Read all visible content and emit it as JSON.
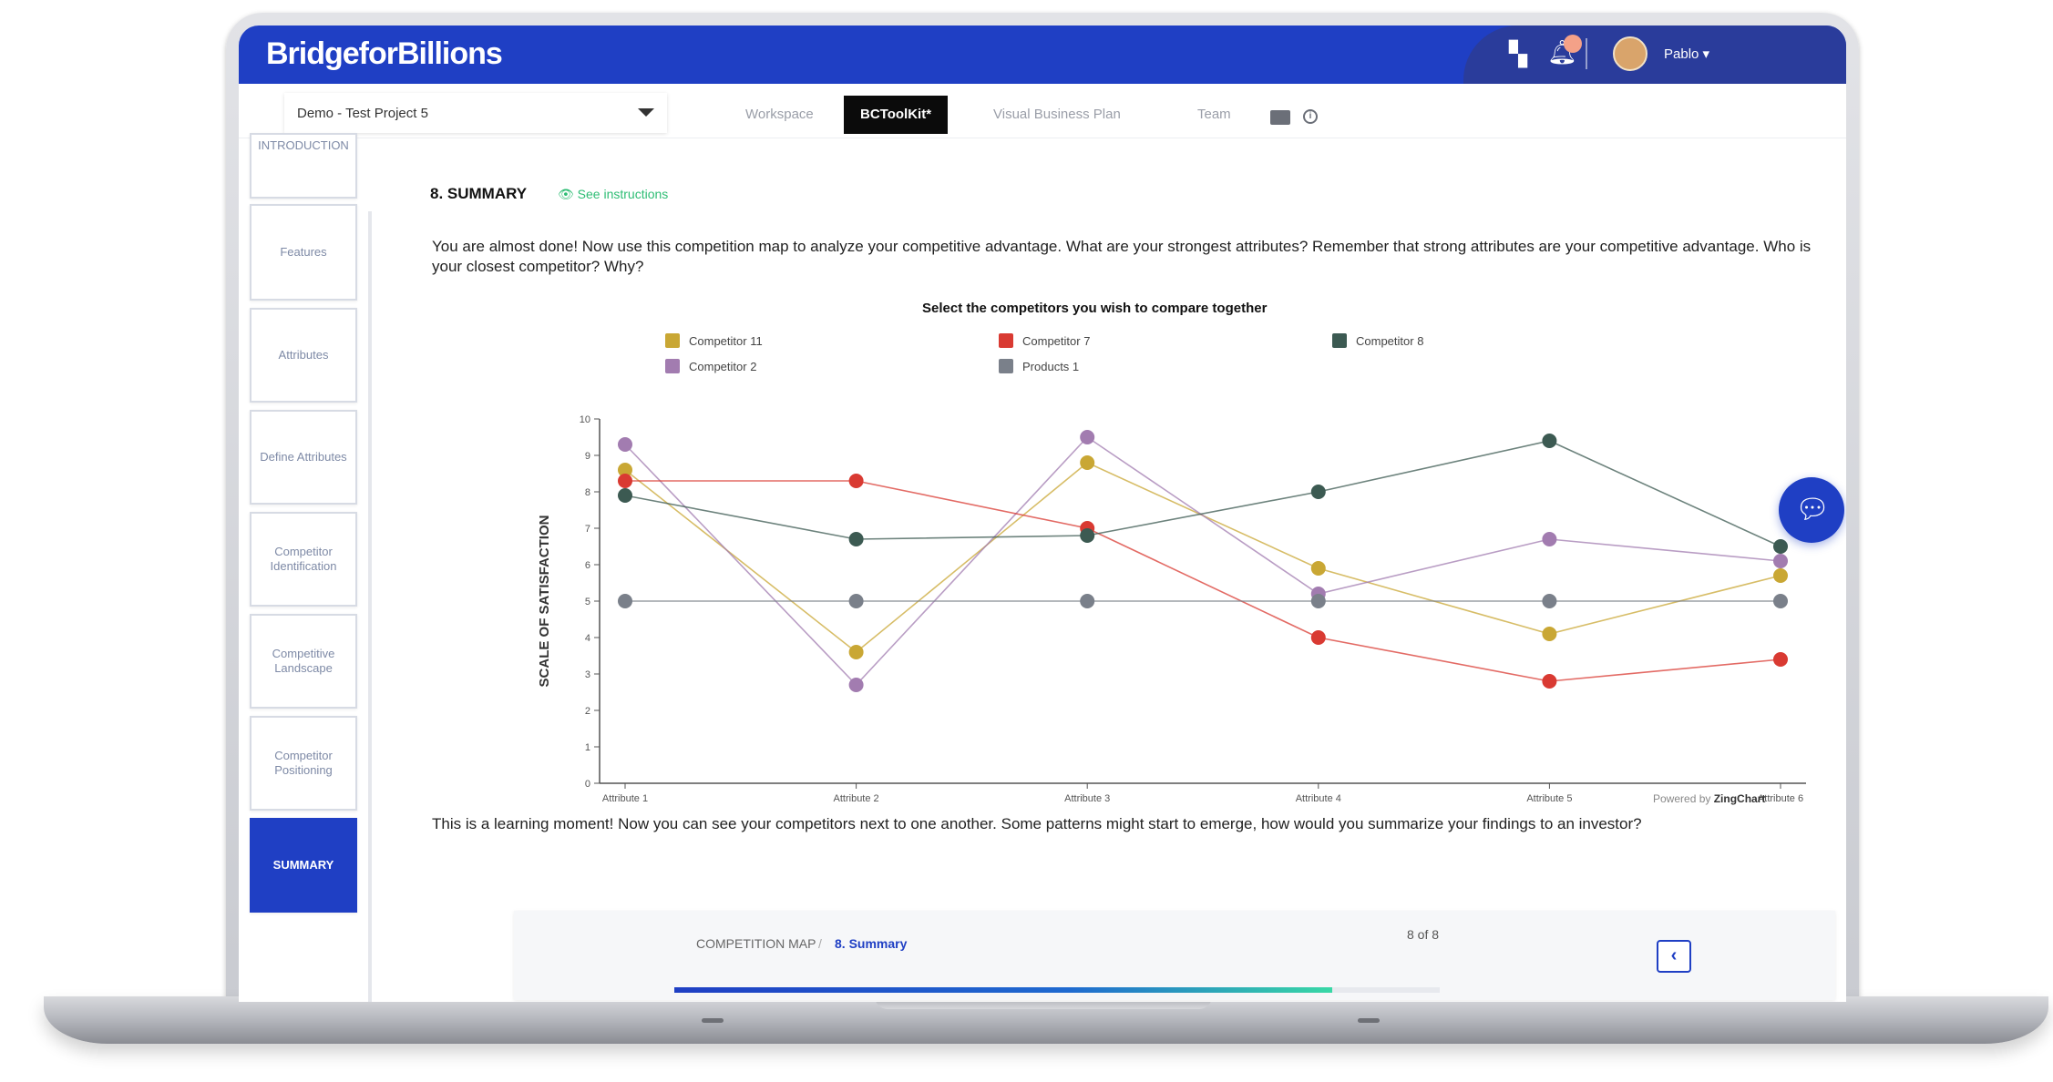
{
  "app": {
    "brand": "BridgeforBillions",
    "user": "Pablo ▾"
  },
  "toolbar": {
    "project": "Demo - Test Project 5",
    "tabs": [
      {
        "label": "Workspace",
        "active": false
      },
      {
        "label": "BCToolKit*",
        "active": true
      },
      {
        "label": "Visual Business Plan",
        "active": false
      },
      {
        "label": "Team",
        "active": false
      }
    ]
  },
  "sidebar": {
    "items": [
      {
        "label": "INTRODUCTION",
        "active": false
      },
      {
        "label": "Features",
        "active": false
      },
      {
        "label": "Attributes",
        "active": false
      },
      {
        "label": "Define Attributes",
        "active": false
      },
      {
        "label": "Competitor Identification",
        "active": false
      },
      {
        "label": "Competitive Landscape",
        "active": false
      },
      {
        "label": "Competitor Positioning",
        "active": false
      },
      {
        "label": "SUMMARY",
        "active": true
      }
    ]
  },
  "main": {
    "section_title": "8. SUMMARY",
    "instructions_link": "👁 See instructions",
    "intro": "You are almost done! Now use this competition map to analyze your competitive advantage. What are your strongest attributes? Remember that strong attributes are your competitive advantage. Who is your closest competitor? Why?",
    "chart_title": "Select the competitors you wish to compare together",
    "powered_by": "Powered by",
    "powered_brand": "ZingChart",
    "outro": "This is a learning moment! Now you can see your competitors next to one another. Some patterns might start to emerge, how would you summarize your findings to an investor?"
  },
  "footer": {
    "crumb": "COMPETITION MAP",
    "crumb_sep": "/",
    "crumb_active": "8. Summary",
    "page_count": "8 of 8",
    "back_label": "‹",
    "progress": 0.86
  },
  "colors": {
    "brand_blue": "#1f3fc4",
    "accent_green": "#2ebd74"
  },
  "chart_data": {
    "type": "line",
    "title": "Select the competitors you wish to compare together",
    "xlabel": "",
    "ylabel": "SCALE OF SATISFACTION",
    "ylim": [
      0,
      10
    ],
    "yticks": [
      0,
      1,
      2,
      3,
      4,
      5,
      6,
      7,
      8,
      9,
      10
    ],
    "categories": [
      "Attribute 1",
      "Attribute 2",
      "Attribute 3",
      "Attribute 4",
      "Attribute 5",
      "Attribute 6"
    ],
    "legend_position": "top",
    "series": [
      {
        "name": "Competitor 11",
        "color": "#c9a734",
        "values": [
          8.6,
          3.6,
          8.8,
          5.9,
          4.1,
          5.7
        ]
      },
      {
        "name": "Competitor 2",
        "color": "#a27cb0",
        "values": [
          9.3,
          2.7,
          9.5,
          5.2,
          6.7,
          6.1
        ]
      },
      {
        "name": "Competitor 7",
        "color": "#d93a32",
        "values": [
          8.3,
          8.3,
          7.0,
          4.0,
          2.8,
          3.4
        ]
      },
      {
        "name": "Products 1",
        "color": "#7a808a",
        "values": [
          5.0,
          5.0,
          5.0,
          5.0,
          5.0,
          5.0
        ]
      },
      {
        "name": "Competitor 8",
        "color": "#3c5a52",
        "values": [
          7.9,
          6.7,
          6.8,
          8.0,
          9.4,
          6.5
        ]
      }
    ]
  }
}
